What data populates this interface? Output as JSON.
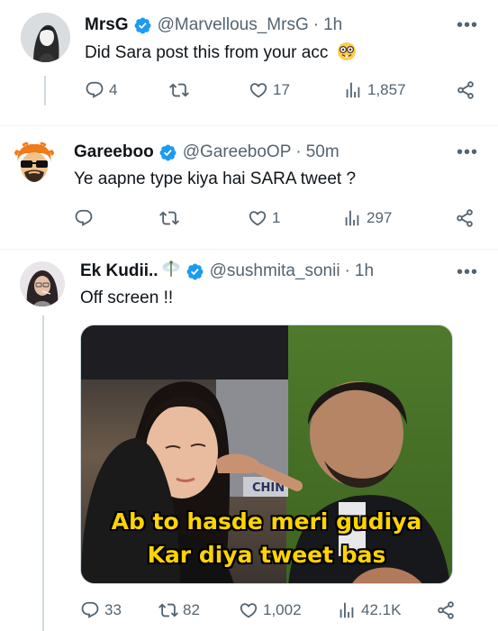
{
  "tweets": [
    {
      "name": "MrsG",
      "handle": "@Marvellous_MrsG",
      "dot": "·",
      "time": "1h",
      "text": "Did Sara post this from your acc",
      "emoji": "nerd-face-emoji",
      "more": "•••",
      "replies": "4",
      "retweets": "",
      "likes": "17",
      "views": "1,857"
    },
    {
      "name": "Gareeboo",
      "handle": "@GareeboOP",
      "dot": "·",
      "time": "50m",
      "text": "Ye aapne type kiya hai SARA tweet ?",
      "more": "•••",
      "replies": "",
      "retweets": "",
      "likes": "1",
      "views": "297"
    },
    {
      "name": "Ek Kudii..",
      "name_emoji": "dragonfly-emoji",
      "handle": "@sushmita_sonii",
      "dot": "·",
      "time": "1h",
      "text": "Off screen !!",
      "more": "•••",
      "media": {
        "caption_line1": "Ab to hasde meri gudiya",
        "caption_line2": "Kar diya tweet bas",
        "backdrop_text": "CHIN"
      },
      "replies": "33",
      "retweets": "82",
      "likes": "1,002",
      "views": "42.1K"
    }
  ],
  "colors": {
    "verified": "#1d9bf0",
    "secondary_text": "#536471",
    "divider": "#eff3f4",
    "thread_line": "#cfd9de",
    "caption": "#ffd400"
  },
  "icons": [
    "reply-icon",
    "retweet-icon",
    "like-icon",
    "views-icon",
    "share-icon",
    "verified-badge-icon",
    "more-icon"
  ]
}
